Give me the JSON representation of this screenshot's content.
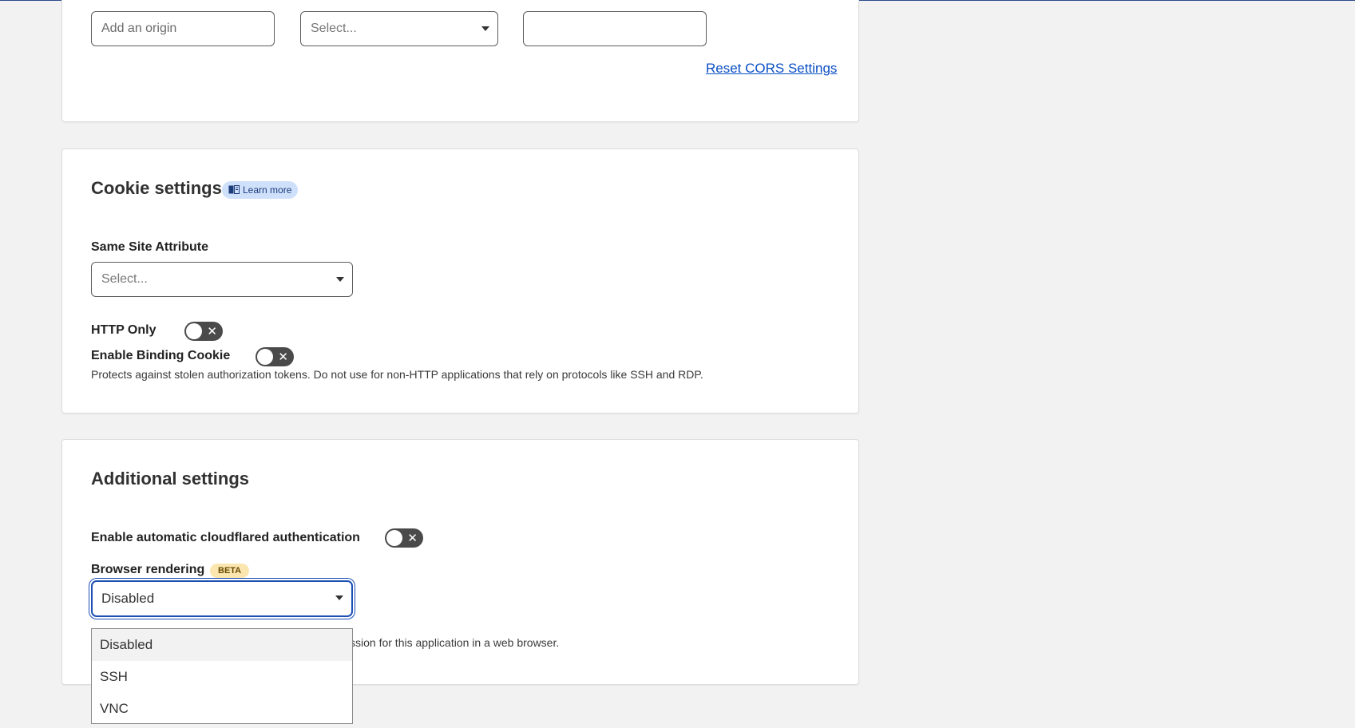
{
  "cors": {
    "origin_placeholder": "Add an origin",
    "select_placeholder": "Select...",
    "third_input_value": "",
    "reset_link": "Reset CORS Settings"
  },
  "cookie": {
    "title": "Cookie settings",
    "learn_more": "Learn more",
    "same_site_label": "Same Site Attribute",
    "same_site_placeholder": "Select...",
    "http_only_label": "HTTP Only",
    "http_only_enabled": false,
    "binding_cookie_label": "Enable Binding Cookie",
    "binding_cookie_enabled": false,
    "binding_cookie_desc": "Protects against stolen authorization tokens. Do not use for non-HTTP applications that rely on protocols like SSH and RDP."
  },
  "additional": {
    "title": "Additional settings",
    "cloudflared_label": "Enable automatic cloudflared authentication",
    "cloudflared_enabled": false,
    "browser_rendering_label": "Browser rendering",
    "beta_badge": "BETA",
    "browser_rendering_value": "Disabled",
    "browser_rendering_desc_visible": "ssion for this application in a web browser.",
    "options": [
      "Disabled",
      "SSH",
      "VNC"
    ],
    "highlighted_option": "Disabled"
  },
  "colors": {
    "link": "#0b4fc4",
    "focus_ring": "#1d4fb3",
    "toggle_off": "#4a4a4a",
    "pill_bg": "#cfe0fb",
    "beta_bg": "#fbe6b0"
  },
  "icons": {
    "learn_more": "book-icon",
    "toggle_off": "x-icon",
    "select": "caret-down-icon"
  }
}
